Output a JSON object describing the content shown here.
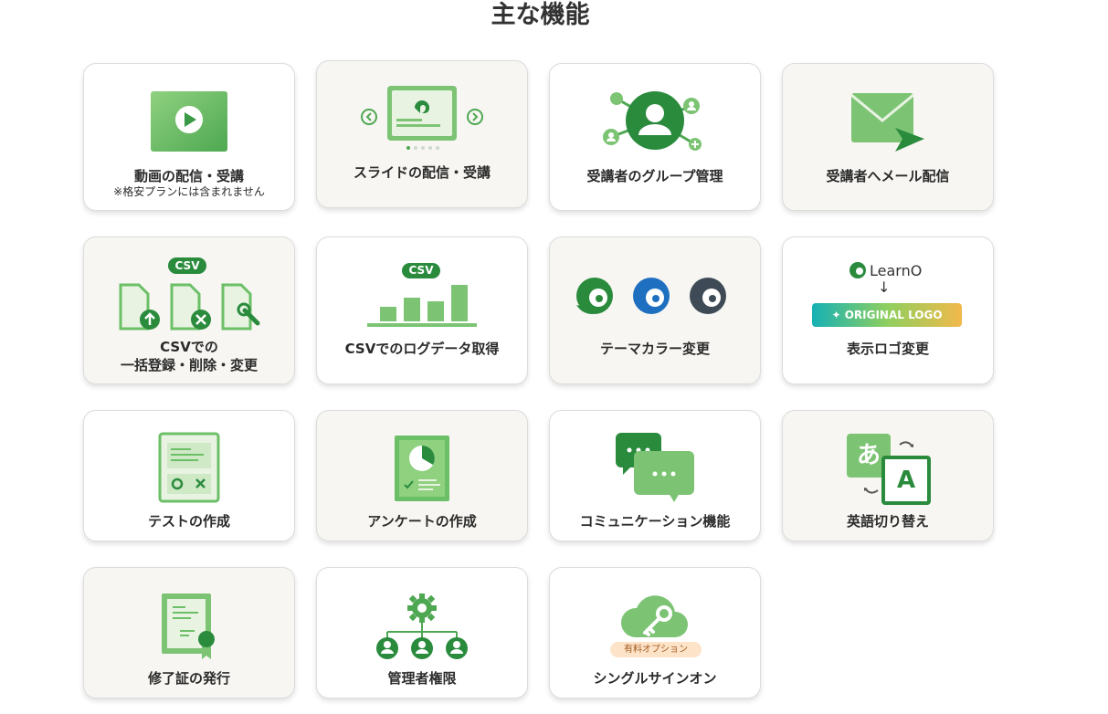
{
  "page": {
    "title": "主な機能"
  },
  "colors": {
    "green": "#3fa24a",
    "green_dark": "#2a8b3d",
    "green_light": "#7cc474",
    "beige": "#f7f6f2",
    "orange": "#fde3c8"
  },
  "features": [
    {
      "label": "動画の配信・受講",
      "sub": "※格安プランには含まれません",
      "icon": "video-play-icon"
    },
    {
      "label": "スライドの配信・受講",
      "icon": "slides-carousel-icon"
    },
    {
      "label": "受講者のグループ管理",
      "icon": "user-group-network-icon"
    },
    {
      "label": "受講者へメール配信",
      "icon": "mail-send-icon"
    },
    {
      "label_line1": "CSVでの",
      "label_line2": "一括登録・削除・変更",
      "badge": "CSV",
      "icon": "csv-files-icon"
    },
    {
      "label": "CSVでのログデータ取得",
      "badge": "CSV",
      "icon": "csv-bar-chart-icon"
    },
    {
      "label": "テーマカラー変更",
      "icon": "theme-color-logos-icon"
    },
    {
      "label": "表示ロゴ変更",
      "brand": "LearnO",
      "arrow": "↓",
      "banner": "ORIGINAL LOGO",
      "icon": "logo-swap-icon"
    },
    {
      "label": "テストの作成",
      "icon": "test-sheet-icon"
    },
    {
      "label": "アンケートの作成",
      "icon": "survey-chart-icon"
    },
    {
      "label": "コミュニケーション機能",
      "icon": "chat-bubbles-icon"
    },
    {
      "label": "英語切り替え",
      "glyph_ja": "あ",
      "glyph_en": "A",
      "icon": "language-switch-icon"
    },
    {
      "label": "修了証の発行",
      "icon": "certificate-icon"
    },
    {
      "label": "管理者権限",
      "icon": "admin-hierarchy-icon"
    },
    {
      "label": "シングルサインオン",
      "badge": "有料オプション",
      "icon": "cloud-key-icon"
    }
  ]
}
